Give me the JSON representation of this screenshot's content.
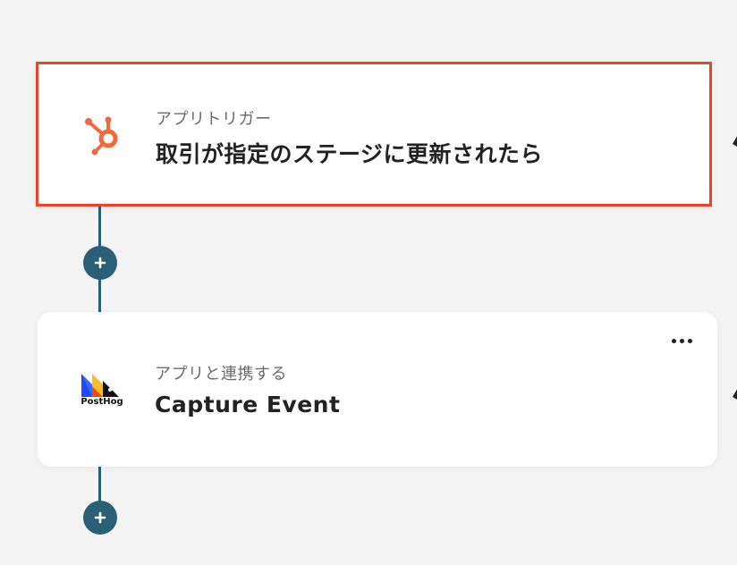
{
  "trigger": {
    "subtitle": "アプリトリガー",
    "title": "取引が指定のステージに更新されたら",
    "app_icon": "hubspot-icon",
    "accent_color": "#e8442a"
  },
  "action": {
    "subtitle": "アプリと連携する",
    "title": "Capture Event",
    "app_icon": "posthog-icon",
    "app_logo_text": "PostHog"
  },
  "connector_color": "#2a5f77",
  "add_icon": "plus-icon",
  "more_icon": "more-horizontal-icon"
}
